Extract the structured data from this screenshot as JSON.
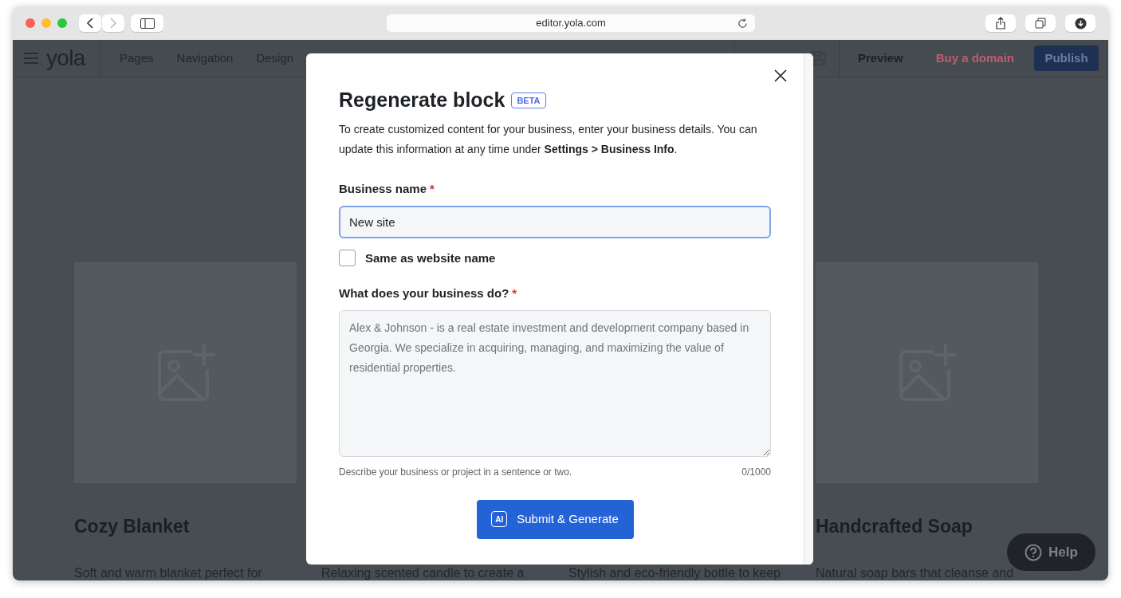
{
  "browser": {
    "url": "editor.yola.com"
  },
  "editor_nav": {
    "logo": "yola",
    "items": [
      "Pages",
      "Navigation",
      "Design"
    ],
    "preview": "Preview",
    "buy_domain": "Buy a domain",
    "publish": "Publish"
  },
  "cards": [
    {
      "image_placeholder": true,
      "title": "Cozy Blanket",
      "description": "Soft and warm blanket perfect for"
    },
    {
      "description": "Relaxing scented candle to create a"
    },
    {
      "description": "Stylish and eco-friendly bottle to keep"
    },
    {
      "image_placeholder": true,
      "title": "Handcrafted Soap",
      "description": "Natural soap bars that cleanse and"
    }
  ],
  "modal": {
    "title": "Regenerate block",
    "badge": "BETA",
    "description": "To create customized content for your business, enter your business details. You can update this information at any time under **Settings > Business Info**.",
    "fields": [
      {
        "kind": "input",
        "label": "Business name",
        "required_mark": "*",
        "value": "New site"
      },
      {
        "kind": "checkbox",
        "label": "Same as website name",
        "checked": false
      },
      {
        "kind": "textarea",
        "label": "What does your business do?",
        "required_mark": "*",
        "placeholder": "Alex & Johnson - is a real estate investment and development company based in Georgia. We specialize in acquiring, managing, and maximizing the value of residential properties.",
        "hint": "Describe your business or project in a sentence or two.",
        "counter": "0/1000"
      }
    ],
    "submit": {
      "icon_text": "AI",
      "label": "Submit & Generate"
    }
  },
  "help": {
    "label": "Help"
  }
}
